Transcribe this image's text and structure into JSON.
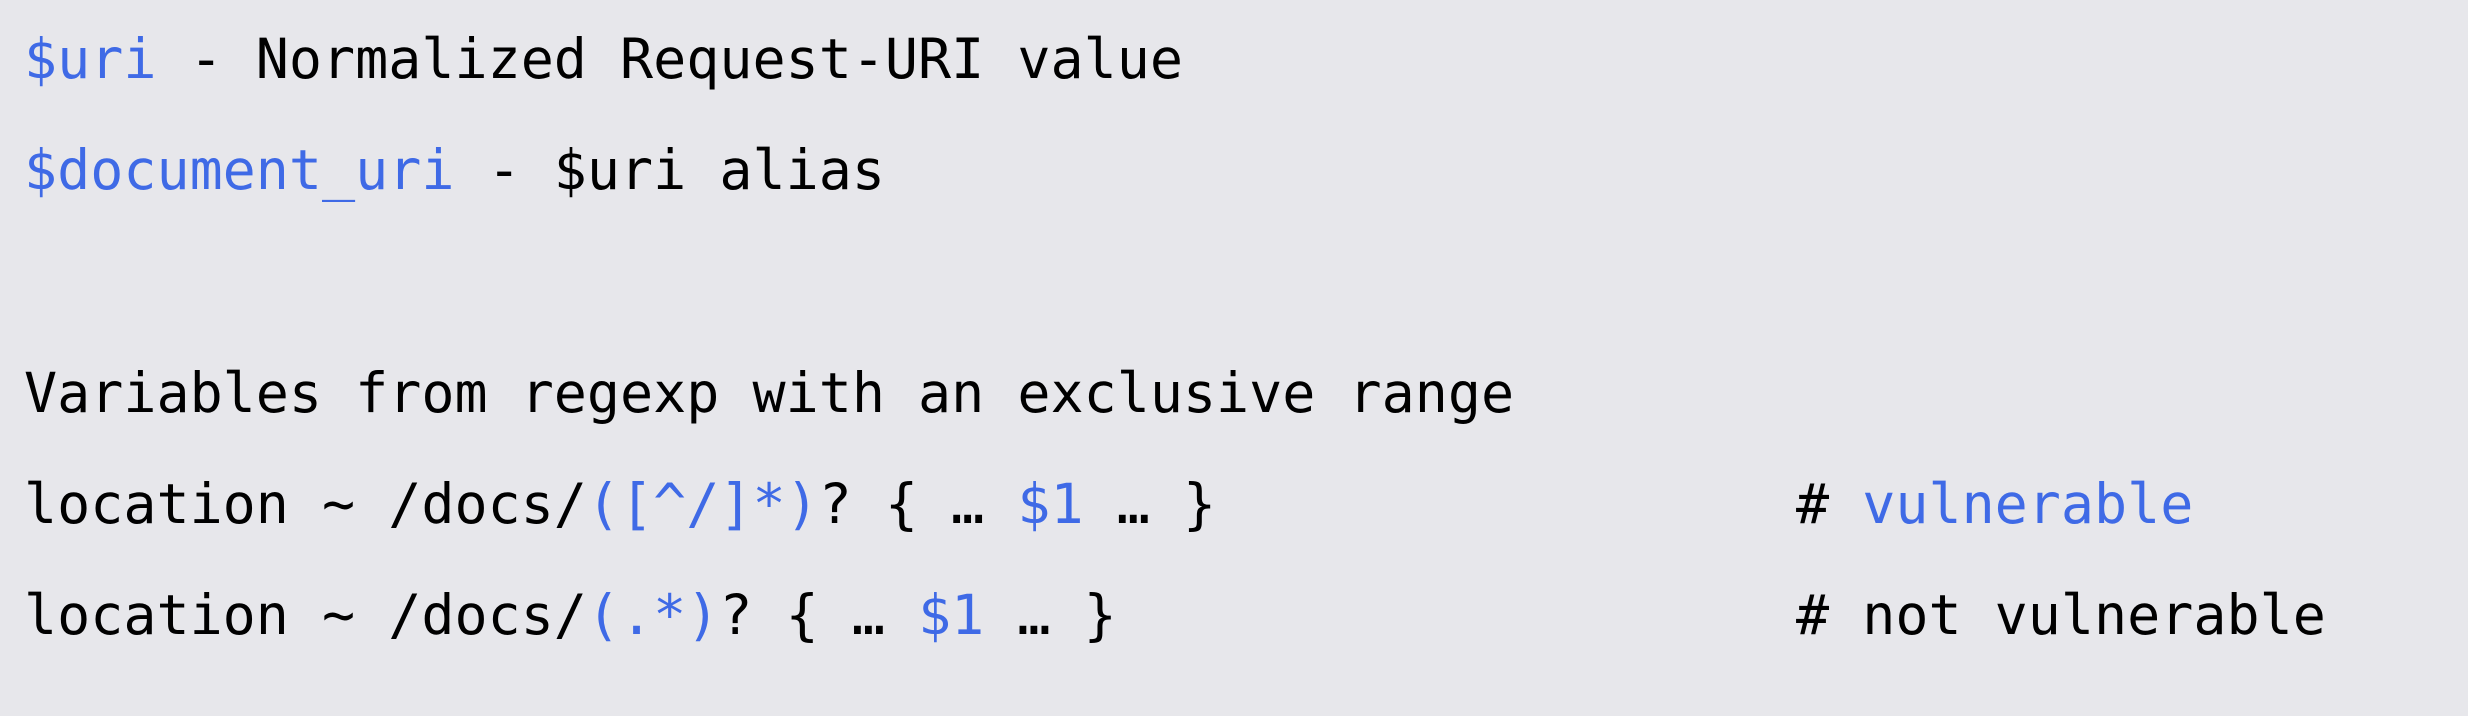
{
  "colors": {
    "background": "#e7e7eb",
    "text": "#000000",
    "highlight": "#3f6ae6"
  },
  "lines": {
    "uri": {
      "var": "$uri",
      "rest": " - Normalized Request-URI value"
    },
    "document_uri": {
      "var": "$document_uri",
      "rest": " - $uri alias"
    },
    "heading": "Variables from regexp with an exclusive range",
    "location_vulnerable": {
      "prefix": "location ~ /docs/",
      "group": "([^/]*)",
      "middle": "? { … ",
      "ref": "$1",
      "suffix": " … }",
      "comment_hash": "# ",
      "comment_text": "vulnerable"
    },
    "location_safe": {
      "prefix": "location ~ /docs/",
      "group": "(.*)",
      "middle": "? { … ",
      "ref": "$1",
      "suffix": " … }",
      "comment": "# not vulnerable"
    }
  }
}
